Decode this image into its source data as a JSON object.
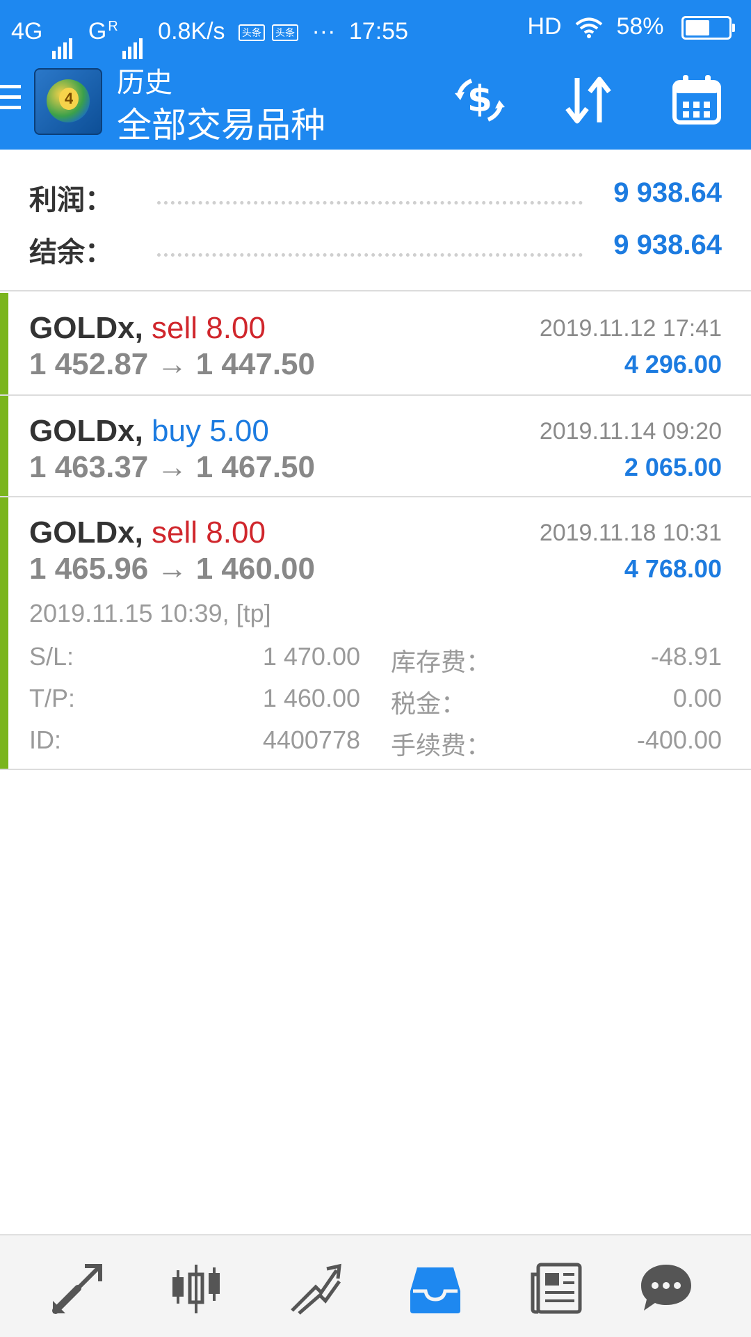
{
  "status_bar": {
    "net1": "4G",
    "net2": "G",
    "net2_sup": "R",
    "speed": "0.8K/s",
    "badge1": "头条",
    "badge2": "头条",
    "more": "···",
    "time": "17:55",
    "hd": "HD",
    "battery": "58%"
  },
  "header": {
    "title": "历史",
    "subtitle": "全部交易品种",
    "icons": [
      "dollar-swap-icon",
      "sort-icon",
      "calendar-icon"
    ]
  },
  "summary": {
    "profit_label": "利润：",
    "profit_value": "9 938.64",
    "balance_label": "结余：",
    "balance_value": "9 938.64"
  },
  "trades": [
    {
      "symbol": "GOLDx,",
      "side": "sell 8.00",
      "prices": "1 452.87 → 1 447.50",
      "time": "2019.11.12 17:41",
      "profit": "4 296.00"
    },
    {
      "symbol": "GOLDx,",
      "side": "buy 5.00",
      "prices": "1 463.37 → 1 467.50",
      "time": "2019.11.14 09:20",
      "profit": "2 065.00"
    },
    {
      "symbol": "GOLDx,",
      "side": "sell 8.00",
      "prices": "1 465.96 → 1 460.00",
      "time": "2019.11.18 10:31",
      "profit": "4 768.00",
      "open_info": "2019.11.15 10:39, [tp]",
      "sl_label": "S/L:",
      "sl_value": "1 470.00",
      "tp_label": "T/P:",
      "tp_value": "1 460.00",
      "id_label": "ID:",
      "id_value": "4400778",
      "swap_label": "库存费：",
      "swap_value": "-48.91",
      "tax_label": "税金：",
      "tax_value": "0.00",
      "fee_label": "手续费：",
      "fee_value": "-400.00"
    }
  ],
  "bottom_nav": [
    "quotes-icon",
    "chart-candles-icon",
    "trade-icon",
    "history-inbox-icon",
    "news-icon",
    "chat-icon"
  ],
  "colors": {
    "accent": "#1E88F0",
    "profit": "#1C7BE0",
    "sell": "#D0262C",
    "row_bar": "#7AB51D"
  }
}
